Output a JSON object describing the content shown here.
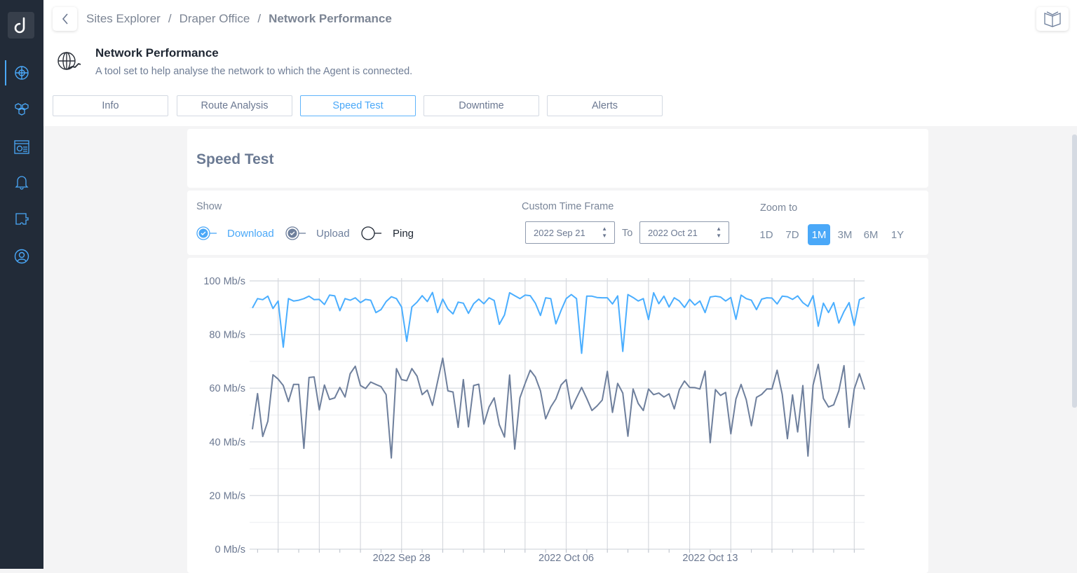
{
  "breadcrumb": {
    "items": [
      "Sites Explorer",
      "Draper Office"
    ],
    "current": "Network Performance",
    "separator": "/"
  },
  "header": {
    "title": "Network Performance",
    "description": "A tool set to help analyse the network to which the Agent is connected."
  },
  "tabs": [
    {
      "label": "Info"
    },
    {
      "label": "Route Analysis"
    },
    {
      "label": "Speed Test",
      "selected": true
    },
    {
      "label": "Downtime"
    },
    {
      "label": "Alerts"
    }
  ],
  "section_title": "Speed Test",
  "controls": {
    "show_label": "Show",
    "series": [
      {
        "label": "Download",
        "checked": true,
        "color": "#4aaeff"
      },
      {
        "label": "Upload",
        "checked": true,
        "color": "#6e7f9c"
      },
      {
        "label": "Ping",
        "checked": false,
        "color": "#1f2733"
      }
    ],
    "time_frame_label": "Custom Time Frame",
    "from": "2022 Sep 21",
    "to_label": "To",
    "to": "2022 Oct 21",
    "zoom_label": "Zoom to",
    "zoom_options": [
      "1D",
      "7D",
      "1M",
      "3M",
      "6M",
      "1Y"
    ],
    "zoom_selected": "1M"
  },
  "colors": {
    "accent": "#4aa8f8",
    "sidebar": "#222b38"
  },
  "sidebar_icons": [
    "globe-network-icon",
    "cubes-icon",
    "dashboard-icon",
    "bell-icon",
    "puzzle-icon",
    "user-circle-icon"
  ],
  "chart_data": {
    "type": "line",
    "ylim": [
      0,
      100
    ],
    "yticks": [
      "0 Mb/s",
      "20 Mb/s",
      "40 Mb/s",
      "60 Mb/s",
      "80 Mb/s",
      "100 Mb/s"
    ],
    "xticks": [
      {
        "date": "2022-09-28",
        "label": "2022 Sep 28"
      },
      {
        "date": "2022-10-06",
        "label": "2022 Oct 06"
      },
      {
        "date": "2022-10-13",
        "label": "2022 Oct 13"
      }
    ],
    "x_start": "2022-09-20T18:00",
    "x_step_hours": 6,
    "grid": true,
    "series": [
      {
        "name": "Download",
        "color": "#4aaeff",
        "values": [
          89.9,
          93.4,
          93,
          94.3,
          89.7,
          92.5,
          75.3,
          93.4,
          92.5,
          92.8,
          93.4,
          94.3,
          93,
          93.1,
          91.2,
          94.7,
          94.4,
          88.9,
          93.4,
          92.8,
          93.7,
          91.9,
          93.1,
          92.8,
          88.2,
          89.3,
          92.3,
          94.1,
          93.4,
          90.3,
          77.5,
          90.3,
          92.1,
          94.5,
          92.3,
          95.7,
          88.2,
          93.2,
          89.5,
          87.7,
          92.1,
          91.7,
          87.9,
          91.5,
          93.2,
          91.5,
          93.7,
          92.7,
          83.8,
          87.3,
          95.6,
          94.5,
          93.4,
          94.7,
          94.5,
          91.7,
          87.1,
          93.7,
          93.4,
          84,
          89,
          93.4,
          94.9,
          93.4,
          73,
          94.3,
          94.3,
          93.8,
          93.7,
          93.7,
          91.4,
          94.4,
          73.7,
          94.9,
          93.8,
          92.5,
          93.4,
          85.6,
          95.6,
          91.5,
          94.3,
          90.3,
          93.7,
          92.5,
          90.1,
          93.1,
          91,
          92.5,
          88.2,
          94,
          94.3,
          94,
          92.5,
          93.8,
          85.7,
          94.7,
          93.4,
          92.8,
          89.3,
          93.2,
          93.7,
          93.6,
          91.4,
          94.3,
          94.1,
          93.1,
          94.4,
          91.9,
          90.5,
          94.5,
          83.1,
          91.7,
          88.2,
          91.9,
          84.3,
          88.6,
          91.9,
          83.4,
          93,
          93.8
        ]
      },
      {
        "name": "Upload",
        "color": "#6e7f9c",
        "values": [
          44.7,
          58,
          42,
          47.7,
          65,
          63.4,
          61,
          55,
          61.4,
          61.4,
          37.6,
          64,
          64.2,
          51.9,
          61.2,
          55.8,
          56.4,
          60.3,
          56.7,
          65.4,
          68.2,
          61,
          59.9,
          62.3,
          61.4,
          60.6,
          57.6,
          34,
          67.3,
          63.2,
          62.8,
          67.3,
          64.5,
          57.6,
          59.3,
          53.6,
          62.5,
          71.2,
          59,
          58.6,
          45.4,
          63.2,
          45.6,
          61,
          61.5,
          46.6,
          53,
          56.4,
          46.4,
          41.8,
          64.9,
          37.3,
          56.4,
          61.7,
          66.7,
          64.2,
          59,
          48.6,
          53,
          56,
          61.2,
          63.2,
          52.3,
          56.4,
          60.3,
          56.2,
          51.7,
          53.4,
          55.6,
          66.3,
          51,
          61.8,
          58.2,
          42.1,
          59.7,
          54.3,
          51.7,
          59.7,
          57.6,
          58.2,
          56.7,
          57.9,
          52.3,
          59.5,
          62.7,
          60.3,
          60.2,
          59.7,
          66.4,
          39.7,
          59.5,
          57.3,
          58.4,
          43,
          56,
          61.4,
          55.7,
          46,
          56.6,
          57.7,
          59.7,
          59.7,
          66.7,
          57.7,
          41.2,
          57.5,
          43.7,
          61,
          34.7,
          61.2,
          68.9,
          56.2,
          53,
          53.8,
          59,
          68.4,
          45.4,
          59.7,
          65.4,
          59.5
        ]
      }
    ]
  }
}
